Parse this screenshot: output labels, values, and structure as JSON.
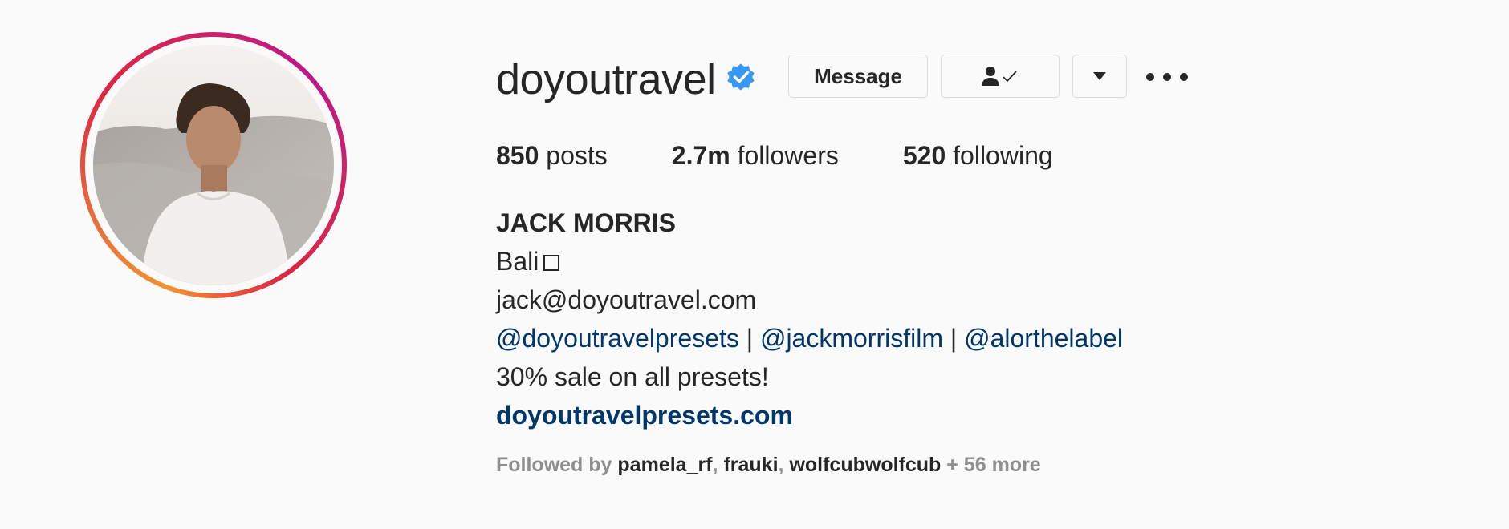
{
  "profile": {
    "username": "doyoutravel",
    "verified": true,
    "buttons": {
      "message_label": "Message",
      "following_icon": "person-check-icon",
      "dropdown_icon": "caret-down-icon",
      "more_icon": "more-horizontal-icon"
    },
    "stats": {
      "posts_count": "850",
      "posts_label": "posts",
      "followers_count": "2.7m",
      "followers_label": "followers",
      "following_count": "520",
      "following_label": "following"
    },
    "bio": {
      "full_name": "JACK MORRIS",
      "location": "Bali",
      "location_glyph": "missing-glyph-box",
      "email": "jack@doyoutravel.com",
      "mentions": [
        "@doyoutravelpresets",
        "@jackmorrisfilm",
        "@alorthelabel"
      ],
      "separator": "|",
      "promo": "30% sale on all presets!",
      "website": "doyoutravelpresets.com"
    },
    "followed_by": {
      "prefix": "Followed by",
      "names": [
        "pamela_rf",
        "frauki",
        "wolfcubwolfcub"
      ],
      "comma": ",",
      "more": "+ 56 more"
    }
  },
  "colors": {
    "background": "#fafafa",
    "text": "#262626",
    "link": "#00376b",
    "muted": "#8e8e8e",
    "verified_blue": "#3897f0",
    "border": "#dbdbdb"
  }
}
